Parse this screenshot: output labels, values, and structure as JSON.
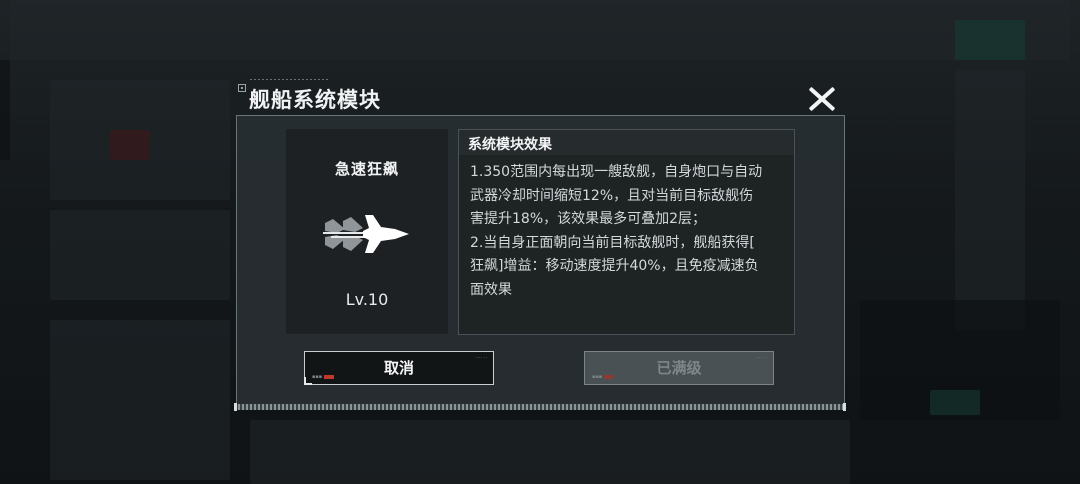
{
  "dialog": {
    "title": "舰船系统模块",
    "module_name": "急速狂飙",
    "module_level": "Lv.10",
    "module_icon": "jet-boost-icon",
    "effect_header": "系统模块效果",
    "effect_text": "1.350范围内每出现一艘敌舰，自身炮口与自动\n武器冷却时间缩短12%，且对当前目标敌舰伤\n害提升18%，该效果最多可叠加2层；\n2.当自身正面朝向当前目标敌舰时，舰船获得[\n狂飙]增益：移动速度提升40%，且免疫减速负\n面效果"
  },
  "buttons": {
    "cancel_label": "取消",
    "max_label": "已满级"
  },
  "colors": {
    "panel_bg": "#282e31",
    "text_primary": "#f3f4f5",
    "disabled_button": "#4a5154"
  }
}
